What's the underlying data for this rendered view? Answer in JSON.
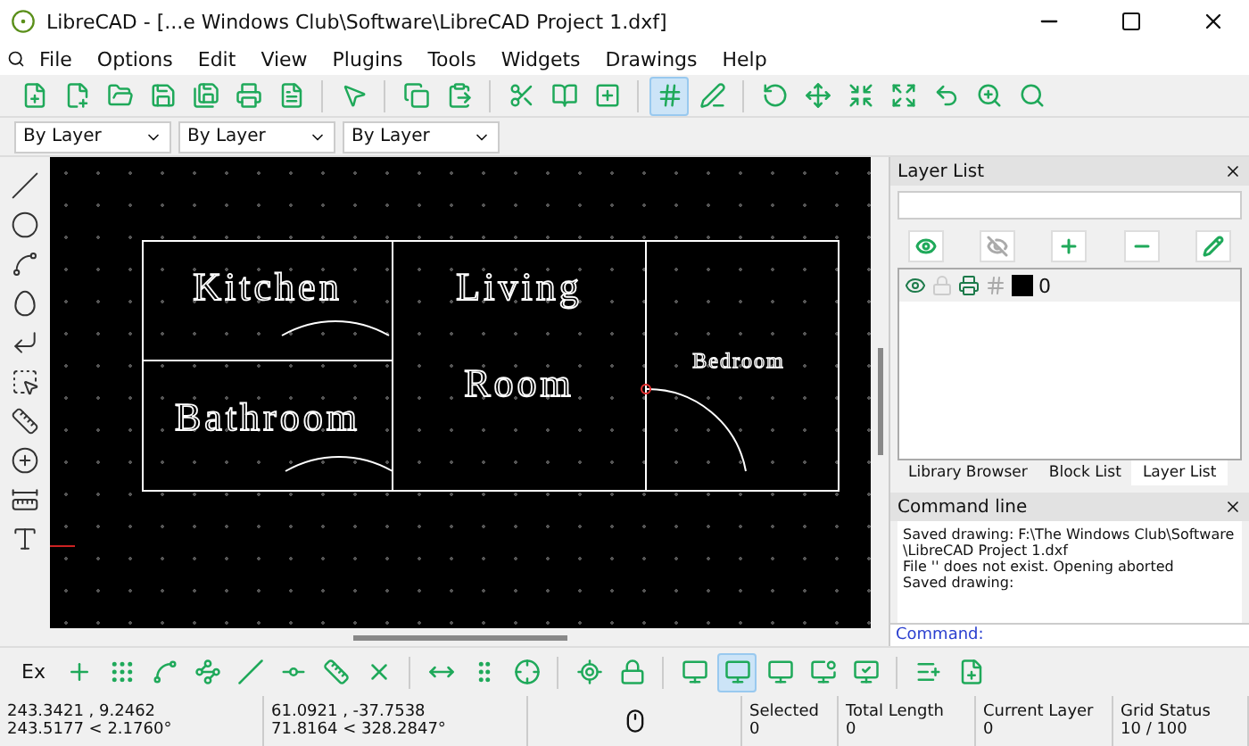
{
  "window": {
    "title": "LibreCAD - [...e Windows Club\\Software\\LibreCAD Project 1.dxf]"
  },
  "menu": [
    "File",
    "Options",
    "Edit",
    "View",
    "Plugins",
    "Tools",
    "Widgets",
    "Drawings",
    "Help"
  ],
  "toolbar": [
    [
      {
        "kind": "new",
        "selected": false
      },
      {
        "kind": "new-template",
        "selected": false
      },
      {
        "kind": "open",
        "selected": false
      },
      {
        "kind": "save",
        "selected": false
      },
      {
        "kind": "save-as",
        "selected": false
      },
      {
        "kind": "print",
        "selected": false
      },
      {
        "kind": "print-preview",
        "selected": false
      }
    ],
    [
      {
        "kind": "select",
        "selected": false
      }
    ],
    [
      {
        "kind": "copy",
        "selected": false
      },
      {
        "kind": "paste",
        "selected": false
      }
    ],
    [
      {
        "kind": "cut",
        "selected": false
      },
      {
        "kind": "block",
        "selected": false
      },
      {
        "kind": "add",
        "selected": false
      }
    ],
    [
      {
        "kind": "grid",
        "selected": true
      },
      {
        "kind": "draft",
        "selected": false
      }
    ],
    [
      {
        "kind": "redraw",
        "selected": false
      },
      {
        "kind": "zoom-in",
        "selected": false
      },
      {
        "kind": "zoom-out",
        "selected": false
      },
      {
        "kind": "zoom-auto",
        "selected": false
      },
      {
        "kind": "zoom-prev",
        "selected": false
      },
      {
        "kind": "zoom-window",
        "selected": false
      },
      {
        "kind": "zoom-pan",
        "selected": false
      }
    ]
  ],
  "properties": [
    "By Layer",
    "By Layer",
    "By Layer"
  ],
  "drawing": {
    "labels": [
      {
        "text": "Kitchen",
        "kind": "large"
      },
      {
        "text": "Living",
        "kind": "large"
      },
      {
        "text": "Room",
        "kind": "large"
      },
      {
        "text": "Bathroom",
        "kind": "large"
      },
      {
        "text": "Bedroom",
        "kind": "small"
      }
    ]
  },
  "layer_panel": {
    "title": "Layer List",
    "layers": [
      {
        "name": "0",
        "visible": true,
        "locked": false,
        "printed": true,
        "color": "#000000"
      }
    ],
    "tabs": [
      {
        "label": "Library Browser",
        "selected": false
      },
      {
        "label": "Block List",
        "selected": false
      },
      {
        "label": "Layer List",
        "selected": true
      }
    ]
  },
  "command_panel": {
    "title": "Command line",
    "lines": [
      "Saved drawing: F:\\The Windows Club\\Software",
      "\\LibreCAD Project 1.dxf",
      "File '' does not exist. Opening aborted",
      "Saved drawing:"
    ],
    "prompt": "Command:"
  },
  "snap_toolbar": {
    "label": "Ex",
    "buttons": [
      [
        {
          "kind": "free",
          "selected": false
        },
        {
          "kind": "grid",
          "selected": false
        },
        {
          "kind": "endpoint",
          "selected": false
        },
        {
          "kind": "entity",
          "selected": false
        },
        {
          "kind": "center",
          "selected": false
        },
        {
          "kind": "middle",
          "selected": false
        },
        {
          "kind": "distance",
          "selected": false
        },
        {
          "kind": "intersection",
          "selected": false
        }
      ],
      [
        {
          "kind": "horizontal",
          "selected": false
        },
        {
          "kind": "vertical",
          "selected": false
        },
        {
          "kind": "ortho",
          "selected": false
        }
      ],
      [
        {
          "kind": "relzero",
          "selected": false
        },
        {
          "kind": "lockzero",
          "selected": false
        }
      ],
      [
        {
          "kind": "view-1",
          "selected": false
        },
        {
          "kind": "view-2",
          "selected": true
        },
        {
          "kind": "view-3",
          "selected": false
        },
        {
          "kind": "view-4",
          "selected": false
        },
        {
          "kind": "view-5",
          "selected": false
        }
      ],
      [
        {
          "kind": "add-1",
          "selected": false
        },
        {
          "kind": "add-2",
          "selected": false
        }
      ]
    ]
  },
  "status_bar": {
    "absolute": [
      "243.3421 , 9.2462",
      "243.5177 < 2.1760°"
    ],
    "relative": [
      "61.0921 , -37.7538",
      "71.8164 < 328.2847°"
    ],
    "fields": [
      {
        "label": "Selected",
        "value": "0"
      },
      {
        "label": "Total Length",
        "value": "0"
      },
      {
        "label": "Current Layer",
        "value": "0"
      },
      {
        "label": "Grid Status",
        "value": "10 / 100"
      }
    ]
  }
}
